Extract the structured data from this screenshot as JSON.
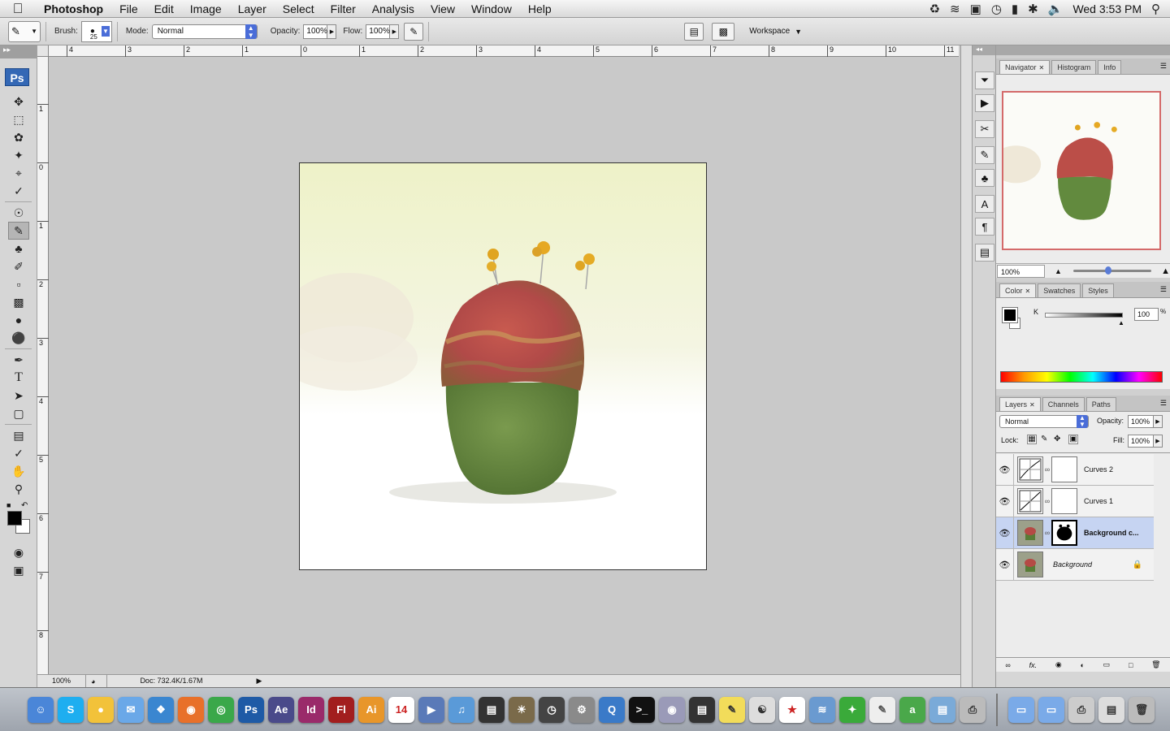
{
  "menubar": {
    "app_name": "Photoshop",
    "items": [
      "File",
      "Edit",
      "Image",
      "Layer",
      "Select",
      "Filter",
      "Analysis",
      "View",
      "Window",
      "Help"
    ],
    "clock": "Wed 3:53 PM"
  },
  "options": {
    "brush_label": "Brush:",
    "brush_size": "25",
    "mode_label": "Mode:",
    "mode_value": "Normal",
    "opacity_label": "Opacity:",
    "opacity_value": "100%",
    "flow_label": "Flow:",
    "flow_value": "100%",
    "workspace_label": "Workspace"
  },
  "toolbox": {
    "logo": "Ps",
    "tools": [
      "move-tool",
      "marquee-tool",
      "lasso-tool",
      "magic-wand-tool",
      "crop-tool",
      "eyedropper-tool",
      "healing-brush-tool",
      "brush-tool",
      "clone-stamp-tool",
      "history-brush-tool",
      "eraser-tool",
      "gradient-tool",
      "blur-tool",
      "dodge-tool",
      "pen-tool",
      "type-tool",
      "path-selection-tool",
      "shape-tool",
      "notes-tool",
      "eyedropper-2-tool",
      "hand-tool",
      "zoom-tool"
    ],
    "active_tool": "brush-tool",
    "foreground_color": "#000000",
    "background_color": "#ffffff"
  },
  "rulers": {
    "top": [
      "4",
      "3",
      "2",
      "1",
      "0",
      "1",
      "2",
      "3",
      "4",
      "5",
      "6",
      "7",
      "8",
      "9",
      "10",
      "11"
    ],
    "left": [
      "1",
      "0",
      "1",
      "2",
      "3",
      "4",
      "5",
      "6",
      "7",
      "8"
    ]
  },
  "document": {
    "zoom": "100%",
    "doc_info": "Doc: 732.4K/1.67M"
  },
  "navigator": {
    "tabs": [
      "Navigator",
      "Histogram",
      "Info"
    ],
    "zoom": "100%",
    "zoom_slider": 0.45
  },
  "color_panel": {
    "tabs": [
      "Color",
      "Swatches",
      "Styles"
    ],
    "channel_label": "K",
    "channel_value": "100",
    "channel_unit": "%"
  },
  "layers_panel": {
    "tabs": [
      "Layers",
      "Channels",
      "Paths"
    ],
    "blend_mode": "Normal",
    "opacity_label": "Opacity:",
    "opacity_value": "100%",
    "lock_label": "Lock:",
    "fill_label": "Fill:",
    "fill_value": "100%",
    "layers": [
      {
        "name": "Curves 2",
        "type": "adjustment",
        "selected": false
      },
      {
        "name": "Curves 1",
        "type": "adjustment",
        "selected": false
      },
      {
        "name": "Background c...",
        "type": "image-mask",
        "selected": true
      },
      {
        "name": "Background",
        "type": "image",
        "selected": false,
        "locked": true
      }
    ]
  },
  "dock": {
    "apps": [
      "Finder",
      "Skype",
      "Adium",
      "iChat",
      "Safari",
      "Firefox",
      "Chrome",
      "Ps",
      "Ae",
      "Id",
      "Fl",
      "Ai",
      "iCal",
      "Preview",
      "iTunes",
      "Dashboard",
      "iPhoto",
      "Time Machine",
      "System Preferences",
      "QuickTime",
      "Terminal",
      "Disk Utility",
      "Clapper",
      "Stickies",
      "Cyberduck",
      "Acrobat",
      "AirPort",
      "Network",
      "Text",
      "Amazon",
      "Script",
      "Printer",
      "Folder",
      "Folder2",
      "Printer2",
      "Trash"
    ]
  }
}
